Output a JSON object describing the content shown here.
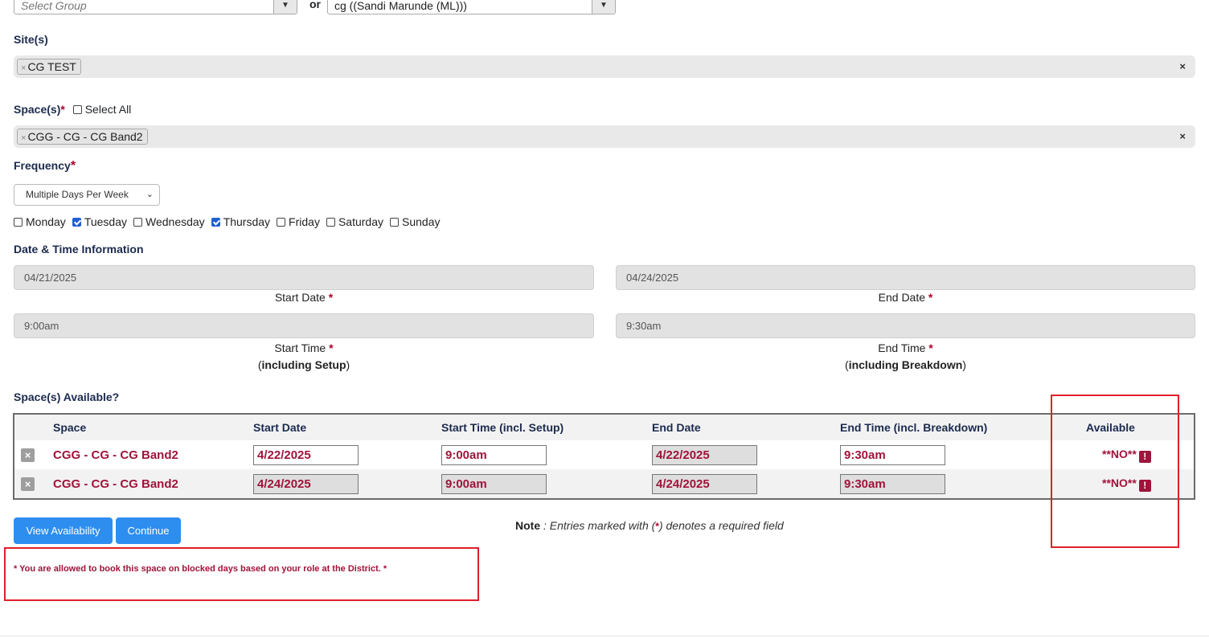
{
  "top": {
    "group_placeholder": "Select Group",
    "or_label": "or",
    "owner_value": "cg ((Sandi Marunde (ML)))"
  },
  "sites": {
    "label": "Site(s)",
    "selected": [
      "CG TEST"
    ],
    "pill_remove": "×",
    "clear": "×"
  },
  "spaces": {
    "label": "Space(s)",
    "required": "*",
    "select_all": "Select All",
    "selected": [
      "CGG - CG - CG Band2"
    ],
    "pill_remove": "×",
    "clear": "×"
  },
  "frequency": {
    "label": "Frequency",
    "required": "*",
    "value": "Multiple Days Per Week",
    "days": [
      {
        "label": "Monday",
        "checked": false
      },
      {
        "label": "Tuesday",
        "checked": true
      },
      {
        "label": "Wednesday",
        "checked": false
      },
      {
        "label": "Thursday",
        "checked": true
      },
      {
        "label": "Friday",
        "checked": false
      },
      {
        "label": "Saturday",
        "checked": false
      },
      {
        "label": "Sunday",
        "checked": false
      }
    ]
  },
  "datetime": {
    "section_label": "Date & Time Information",
    "start_date": "04/21/2025",
    "end_date": "04/24/2025",
    "start_date_label": "Start Date",
    "end_date_label": "End Date",
    "start_time": "9:00am",
    "end_time": "9:30am",
    "start_time_label": "Start Time",
    "end_time_label": "End Time",
    "start_time_note": "including Setup",
    "end_time_note": "including Breakdown",
    "required": "*"
  },
  "availability": {
    "label": "Space(s) Available?",
    "columns": [
      "Space",
      "Start Date",
      "Start Time (incl. Setup)",
      "End Date",
      "End Time (incl. Breakdown)",
      "Available"
    ],
    "rows": [
      {
        "space": "CGG - CG - CG Band2",
        "start_date": "4/22/2025",
        "start_time": "9:00am",
        "end_date": "4/22/2025",
        "end_time": "9:30am",
        "available": "**NO**"
      },
      {
        "space": "CGG - CG - CG Band2",
        "start_date": "4/24/2025",
        "start_time": "9:00am",
        "end_date": "4/24/2025",
        "end_time": "9:30am",
        "available": "**NO**"
      }
    ],
    "remove_glyph": "×",
    "warn_glyph": "!"
  },
  "actions": {
    "view_availability": "View Availability",
    "continue": "Continue"
  },
  "note": {
    "bold": "Note",
    "text": " : Entries marked with (",
    "star": "*",
    "text_end": ") denotes a required field"
  },
  "blocked_message": "* You are allowed to book this space on blocked days based on your role at the District. *",
  "colors": {
    "accent": "#2d8ef0",
    "required": "#b0002a",
    "value_text": "#a0133a",
    "annotation_red": "#e01f2a",
    "heading": "#1b2a4e"
  }
}
